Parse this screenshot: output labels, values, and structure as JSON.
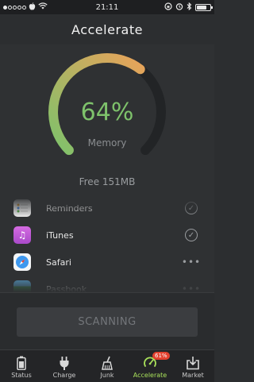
{
  "status_bar": {
    "carrier_dots": [
      true,
      false,
      false,
      false,
      false
    ],
    "time": "21:11",
    "battery_level": 0.75
  },
  "header": {
    "title": "Accelerate"
  },
  "gauge": {
    "percent_text": "64%",
    "percent_value": 64,
    "label": "Memory",
    "free_text": "Free 151MB",
    "colors": {
      "start": "#7ec26b",
      "end": "#e8a35a",
      "track": "#222426"
    }
  },
  "apps": [
    {
      "name": "Reminders",
      "icon": "reminders-icon",
      "icon_color": "#ffffff",
      "action": "checked"
    },
    {
      "name": "iTunes",
      "icon": "itunes-icon",
      "icon_color": "#c25fd6",
      "action": "checked"
    },
    {
      "name": "Safari",
      "icon": "safari-icon",
      "icon_color": "#2f8fe8",
      "action": "more"
    },
    {
      "name": "Passbook",
      "icon": "passbook-icon",
      "icon_color": "#3a9a56",
      "action": "more"
    }
  ],
  "scan": {
    "label": "SCANNING"
  },
  "tabs": [
    {
      "label": "Status",
      "icon": "battery-icon",
      "active": false
    },
    {
      "label": "Charge",
      "icon": "plug-icon",
      "active": false
    },
    {
      "label": "Junk",
      "icon": "broom-icon",
      "active": false
    },
    {
      "label": "Accelerate",
      "icon": "accelerate-icon",
      "active": true,
      "badge": "61%"
    },
    {
      "label": "Market",
      "icon": "download-icon",
      "active": false
    }
  ]
}
